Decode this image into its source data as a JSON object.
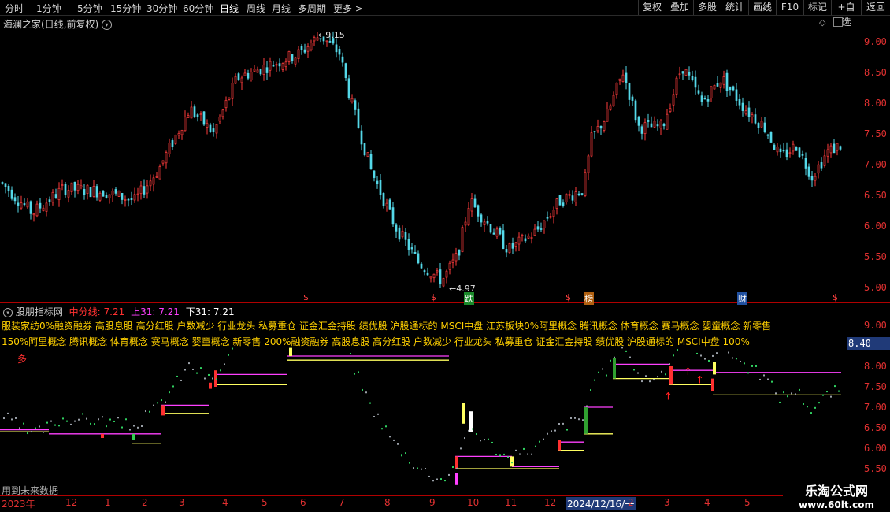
{
  "toolbar": {
    "timeframes": [
      "分时",
      "1分钟",
      "5分钟",
      "15分钟",
      "30分钟",
      "60分钟",
      "日线",
      "周线",
      "月线",
      "多周期",
      "更多 >"
    ],
    "active_timeframe": "日线",
    "right_buttons": [
      "复权",
      "叠加",
      "多股",
      "统计",
      "画线",
      "F10",
      "标记",
      "+自选",
      "返回"
    ]
  },
  "main_chart": {
    "title": "海澜之家(日线,前复权)",
    "y_ticks": [
      "9.00",
      "8.50",
      "8.00",
      "7.50",
      "7.00",
      "6.50",
      "6.00",
      "5.50",
      "5.00"
    ],
    "high_label": "9.15",
    "low_label": "4.97",
    "event_markers": [
      "$",
      "$",
      "跌",
      "$",
      "榜",
      "财",
      "$"
    ],
    "colors": {
      "up": "#ff3c3c",
      "down": "#54d8e8",
      "axis": "#e03030"
    }
  },
  "indicator": {
    "name": "股朋指标网",
    "mid_label": "中分线: 7.21",
    "upper_label": "上31: 7.21",
    "lower_label": "下31: 7.21",
    "concepts_line1": "服装家纺0%融资融券 高股息股 高分红股 户数减少 行业龙头 私募重仓 证金汇金持股 绩优股 沪股通标的 MSCI中盘 江苏板块0%阿里概念 腾讯概念 体育概念 赛马概念 婴童概念 新零售",
    "concepts_line2": "150%阿里概念 腾讯概念 体育概念 赛马概念 婴童概念 新零售 200%融资融券 高股息股 高分红股 户数减少 行业龙头 私募重仓 证金汇金持股 绩优股 沪股通标的 MSCI中盘 100%",
    "duo": "多",
    "future_note": "用到未来数据",
    "y_ticks": [
      "9.00",
      "8.50",
      "8.00",
      "7.50",
      "7.00",
      "6.50",
      "6.00",
      "5.50"
    ],
    "current_value": "8.40"
  },
  "xaxis": {
    "labels": [
      "2023年",
      "12",
      "1",
      "2",
      "3",
      "4",
      "5",
      "6",
      "7",
      "8",
      "9",
      "10",
      "11",
      "12",
      "2024/12/16/一",
      "2",
      "3",
      "4",
      "5"
    ]
  },
  "watermark": {
    "title": "乐淘公式网",
    "url": "www.60lt.com"
  }
}
